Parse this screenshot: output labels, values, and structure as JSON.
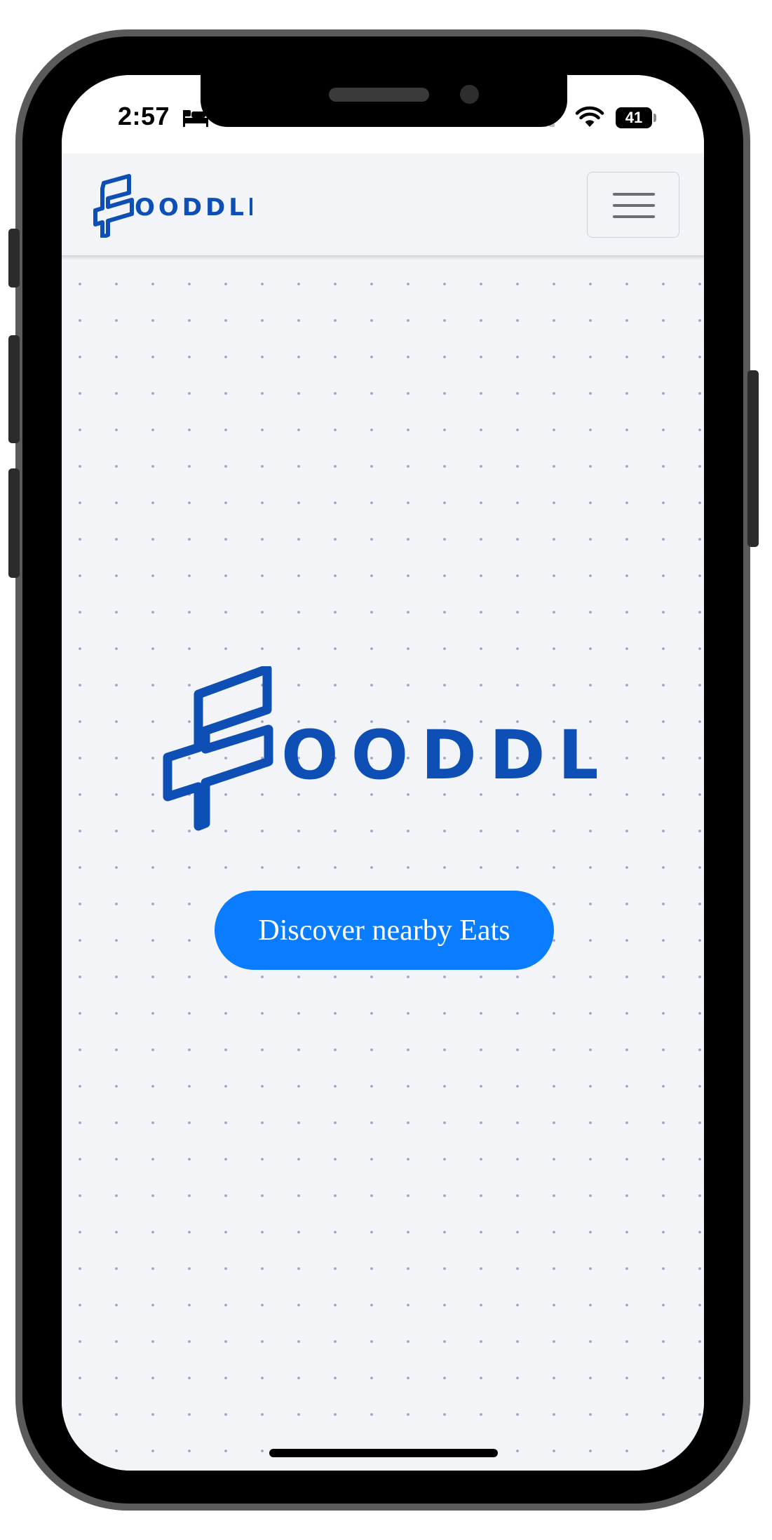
{
  "status_bar": {
    "time": "2:57",
    "battery_level": "41",
    "icons": [
      "sleep-focus-icon",
      "cellular-signal-icon",
      "wifi-icon",
      "battery-icon"
    ]
  },
  "navbar": {
    "logo_text": "OODDLE",
    "menu_icon": "hamburger-menu-icon"
  },
  "hero": {
    "logo_text": "OODDLE",
    "cta_label": "Discover nearby Eats"
  },
  "colors": {
    "brand": "#0d4fb5",
    "cta": "#0a7cff",
    "background": "#f2f4f7",
    "dots": "#9aa3c7"
  }
}
